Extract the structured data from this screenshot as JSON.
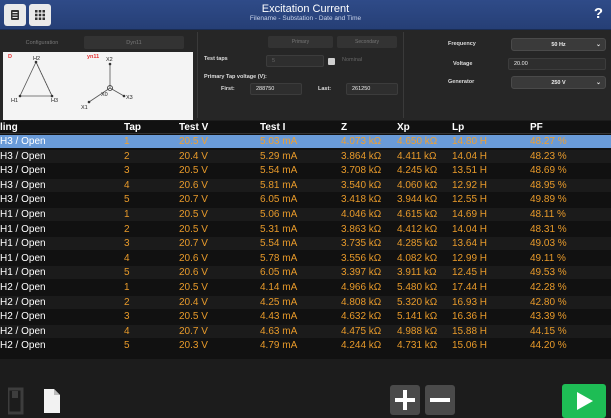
{
  "header": {
    "title": "Excitation Current",
    "subtitle": "Filename - Substation - Date and Time",
    "help_label": "?"
  },
  "config": {
    "tab_configuration": "Configuration",
    "tab_vector": "Dyn11",
    "diagram": {
      "primary_label": "D",
      "secondary_label": "yn11",
      "terminals": [
        "H2",
        "X2",
        "H1",
        "H3",
        "X0",
        "X1",
        "X3"
      ]
    },
    "primary_btn": "Primary",
    "secondary_btn": "Secondary",
    "test_taps_label": "Test taps",
    "test_taps_value": "5",
    "nominal_label": "Nominal",
    "primary_tap_voltage_label": "Primary Tap voltage (V):",
    "first_label": "First:",
    "first_value": "288750",
    "last_label": "Last:",
    "last_value": "261250",
    "frequency_label": "Frequency",
    "frequency_value": "50 Hz",
    "voltage_label": "Voltage",
    "voltage_value": "20.00",
    "generator_label": "Generator",
    "generator_value": "250 V"
  },
  "table": {
    "columns": [
      "ling",
      "Tap",
      "Test V",
      "Test I",
      "Z",
      "Xp",
      "Lp",
      "PF"
    ],
    "rows": [
      [
        "H3 / Open",
        "1",
        "20.5 V",
        "5.03 mA",
        "4.073 kΩ",
        "4.650 kΩ",
        "14.80 H",
        "48.27 %"
      ],
      [
        "H3 / Open",
        "2",
        "20.4 V",
        "5.29 mA",
        "3.864 kΩ",
        "4.411 kΩ",
        "14.04 H",
        "48.23 %"
      ],
      [
        "H3 / Open",
        "3",
        "20.5 V",
        "5.54 mA",
        "3.708 kΩ",
        "4.245 kΩ",
        "13.51 H",
        "48.69 %"
      ],
      [
        "H3 / Open",
        "4",
        "20.6 V",
        "5.81 mA",
        "3.540 kΩ",
        "4.060 kΩ",
        "12.92 H",
        "48.95 %"
      ],
      [
        "H3 / Open",
        "5",
        "20.7 V",
        "6.05 mA",
        "3.418 kΩ",
        "3.944 kΩ",
        "12.55 H",
        "49.89 %"
      ],
      [
        "H1 / Open",
        "1",
        "20.5 V",
        "5.06 mA",
        "4.046 kΩ",
        "4.615 kΩ",
        "14.69 H",
        "48.11 %"
      ],
      [
        "H1 / Open",
        "2",
        "20.5 V",
        "5.31 mA",
        "3.863 kΩ",
        "4.412 kΩ",
        "14.04 H",
        "48.31 %"
      ],
      [
        "H1 / Open",
        "3",
        "20.7 V",
        "5.54 mA",
        "3.735 kΩ",
        "4.285 kΩ",
        "13.64 H",
        "49.03 %"
      ],
      [
        "H1 / Open",
        "4",
        "20.6 V",
        "5.78 mA",
        "3.556 kΩ",
        "4.082 kΩ",
        "12.99 H",
        "49.11 %"
      ],
      [
        "H1 / Open",
        "5",
        "20.6 V",
        "6.05 mA",
        "3.397 kΩ",
        "3.911 kΩ",
        "12.45 H",
        "49.53 %"
      ],
      [
        "H2 / Open",
        "1",
        "20.5 V",
        "4.14 mA",
        "4.966 kΩ",
        "5.480 kΩ",
        "17.44 H",
        "42.28 %"
      ],
      [
        "H2 / Open",
        "2",
        "20.4 V",
        "4.25 mA",
        "4.808 kΩ",
        "5.320 kΩ",
        "16.93 H",
        "42.80 %"
      ],
      [
        "H2 / Open",
        "3",
        "20.5 V",
        "4.43 mA",
        "4.632 kΩ",
        "5.141 kΩ",
        "16.36 H",
        "43.39 %"
      ],
      [
        "H2 / Open",
        "4",
        "20.7 V",
        "4.63 mA",
        "4.475 kΩ",
        "4.988 kΩ",
        "15.88 H",
        "44.15 %"
      ],
      [
        "H2 / Open",
        "5",
        "20.3 V",
        "4.79 mA",
        "4.244 kΩ",
        "4.731 kΩ",
        "15.06 H",
        "44.20 %"
      ]
    ],
    "selected_row": 0
  },
  "colors": {
    "header_bg": "#2f4b88",
    "selected_row": "#6a9bd8",
    "value_orange": "#e89a2a",
    "run_button": "#1ebd55"
  },
  "icons": {
    "header_left": "document-list-icon",
    "header_right": "grid-icon",
    "bottom_left": [
      "save-icon",
      "new-document-icon"
    ],
    "bottom_middle": [
      "plus-icon",
      "minus-icon"
    ],
    "bottom_right": "play-icon"
  }
}
